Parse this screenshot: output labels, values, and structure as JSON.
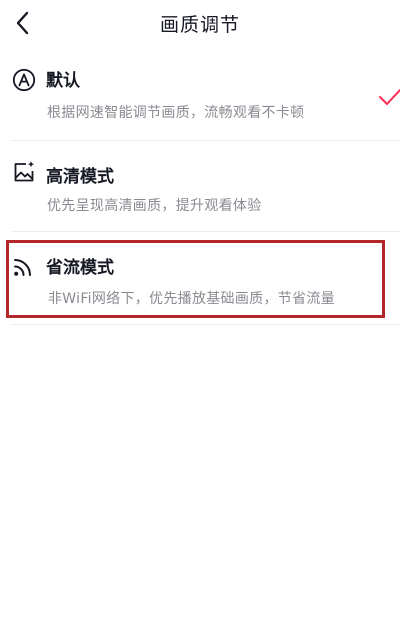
{
  "header": {
    "title": "画质调节",
    "back_icon": "chevron-left-icon"
  },
  "options": [
    {
      "title": "默认",
      "desc": "根据网速智能调节画质，流畅观看不卡顿",
      "icon": "auto-a-icon",
      "selected": true
    },
    {
      "title": "高清模式",
      "desc": "优先呈现高清画质，提升观看体验",
      "icon": "hd-image-icon",
      "selected": false
    },
    {
      "title": "省流模式",
      "desc": "非WiFi网络下，优先播放基础画质，节省流量",
      "icon": "signal-waves-icon",
      "selected": false,
      "highlighted": true
    }
  ],
  "colors": {
    "check_accent": "#fe2c55",
    "highlight_border": "#b3272b",
    "title_text": "#161823",
    "desc_text": "#8a8b91",
    "divider": "#ececee"
  }
}
